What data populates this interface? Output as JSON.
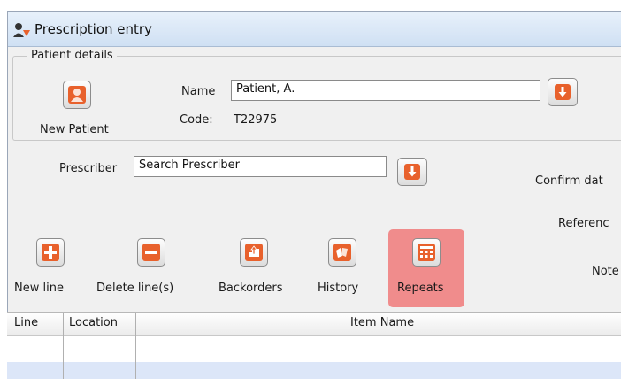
{
  "window": {
    "title": "Prescription entry"
  },
  "patient_details": {
    "legend": "Patient details",
    "new_patient_label": "New Patient",
    "name_label": "Name",
    "name_value": "Patient, A.",
    "code_label": "Code:",
    "code_value": "T22975"
  },
  "prescriber": {
    "label": "Prescriber",
    "value": "Search Prescriber"
  },
  "right_labels": {
    "confirm_date": "Confirm dat",
    "reference": "Referenc",
    "notes": "Note"
  },
  "toolbar": {
    "new_line": "New line",
    "delete_lines": "Delete line(s)",
    "backorders": "Backorders",
    "history": "History",
    "repeats": "Repeats"
  },
  "table": {
    "columns": [
      "Line",
      "Location",
      "Item Name"
    ]
  },
  "colors": {
    "accent_orange": "#e8612c",
    "repeats_highlight": "#f08c8c",
    "row_alt": "#dce6f8"
  }
}
